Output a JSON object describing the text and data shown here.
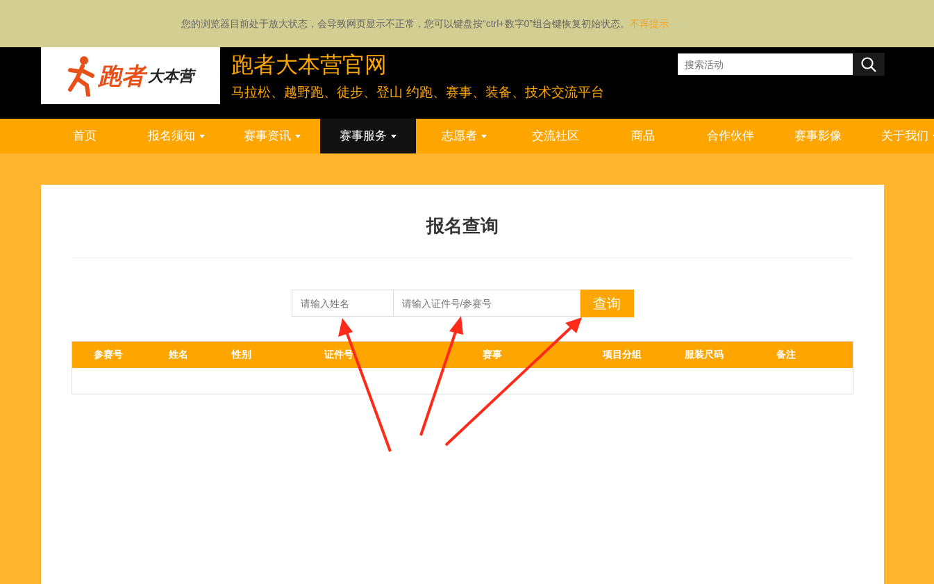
{
  "notice": {
    "text": "您的浏览器目前处于放大状态，会导致网页显示不正常，您可以键盘按“ctrl+数字0”组合键恢复初始状态。",
    "link": "不再提示"
  },
  "header": {
    "logo": {
      "text_main": "跑者",
      "text_sub": "大本营"
    },
    "site_title": "跑者大本营官网",
    "tagline": "马拉松、越野跑、徒步、登山 约跑、赛事、装备、技术交流平台",
    "search": {
      "placeholder": "搜索活动"
    }
  },
  "nav": [
    {
      "label": "首页",
      "dropdown": false,
      "selected": false
    },
    {
      "label": "报名须知",
      "dropdown": true,
      "selected": false
    },
    {
      "label": "赛事资讯",
      "dropdown": true,
      "selected": false
    },
    {
      "label": "赛事服务",
      "dropdown": true,
      "selected": true
    },
    {
      "label": "志愿者",
      "dropdown": true,
      "selected": false
    },
    {
      "label": "交流社区",
      "dropdown": false,
      "selected": false
    },
    {
      "label": "商品",
      "dropdown": false,
      "selected": false
    },
    {
      "label": "合作伙伴",
      "dropdown": false,
      "selected": false
    },
    {
      "label": "赛事影像",
      "dropdown": false,
      "selected": false
    },
    {
      "label": "关于我们",
      "dropdown": true,
      "selected": false
    }
  ],
  "panel": {
    "title": "报名查询",
    "form": {
      "name_placeholder": "请输入姓名",
      "id_placeholder": "请输入证件号/参赛号",
      "button": "查询"
    },
    "table": {
      "columns": [
        "参赛号",
        "姓名",
        "性别",
        "证件号",
        "赛事",
        "项目分组",
        "服装尺码",
        "备注"
      ]
    }
  }
}
